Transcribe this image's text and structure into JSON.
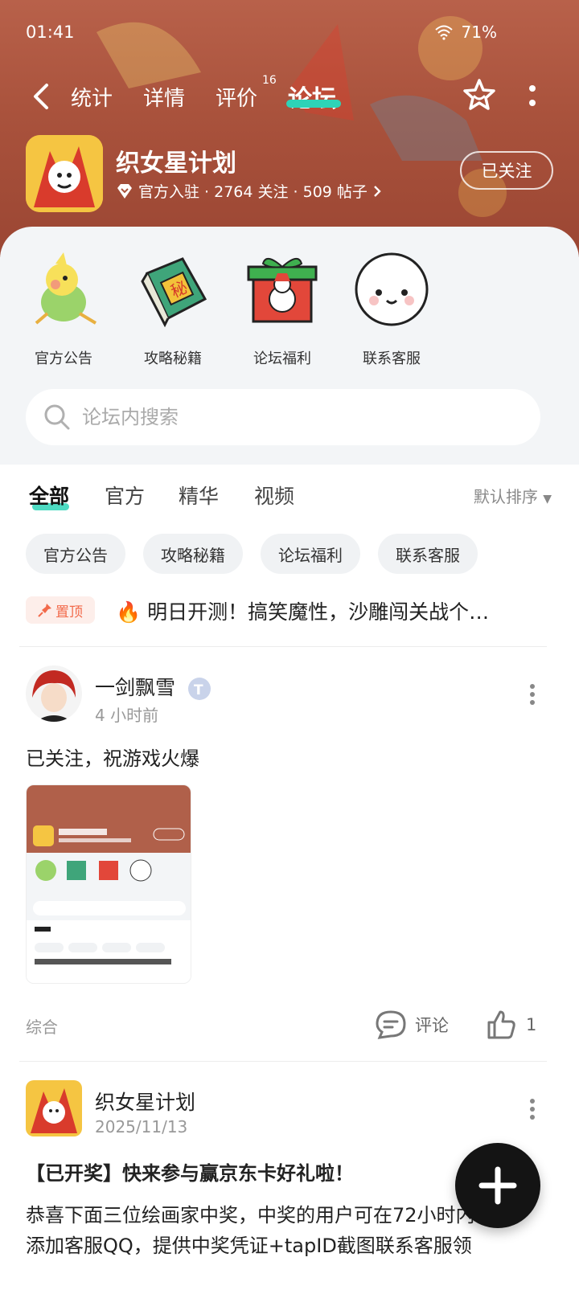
{
  "status": {
    "time": "01:41",
    "battery": "71%"
  },
  "nav": {
    "tabs": [
      "统计",
      "详情",
      "评价",
      "论坛"
    ],
    "review_badge": "16",
    "active_tab": "论坛"
  },
  "game": {
    "name": "织女星计划",
    "meta": "官方入驻 · 2764 关注 · 509 帖子",
    "follow_label": "已关注"
  },
  "quick_links": [
    {
      "label": "官方公告",
      "icon": "parrot-icon"
    },
    {
      "label": "攻略秘籍",
      "icon": "secret-book-icon"
    },
    {
      "label": "论坛福利",
      "icon": "gift-box-icon"
    },
    {
      "label": "联系客服",
      "icon": "customer-service-icon"
    }
  ],
  "search": {
    "placeholder": "论坛内搜索"
  },
  "filter_tabs": [
    "全部",
    "官方",
    "精华",
    "视频"
  ],
  "sort_label": "默认排序",
  "chips": [
    "官方公告",
    "攻略秘籍",
    "论坛福利",
    "联系客服"
  ],
  "pinned": {
    "badge": "置顶",
    "text": "🔥 明日开测！搞笑魔性，沙雕闯关战个…"
  },
  "posts": [
    {
      "author": "一剑飘雪",
      "time": "4 小时前",
      "text": "已关注，祝游戏火爆",
      "category": "综合",
      "comment_label": "评论",
      "likes": "1"
    },
    {
      "author": "织女星计划",
      "time": "2025/11/13",
      "title": "【已开奖】快来参与赢京东卡好礼啦！",
      "body_line1": "恭喜下面三位绘画家中奖，中奖的用户可在72小时内",
      "body_line2": "添加客服QQ，提供中奖凭证+tapID截图联系客服领"
    }
  ],
  "colors": {
    "accent": "#2ed3b7",
    "banner": "#a9523c",
    "pin": "#f26a4b"
  }
}
